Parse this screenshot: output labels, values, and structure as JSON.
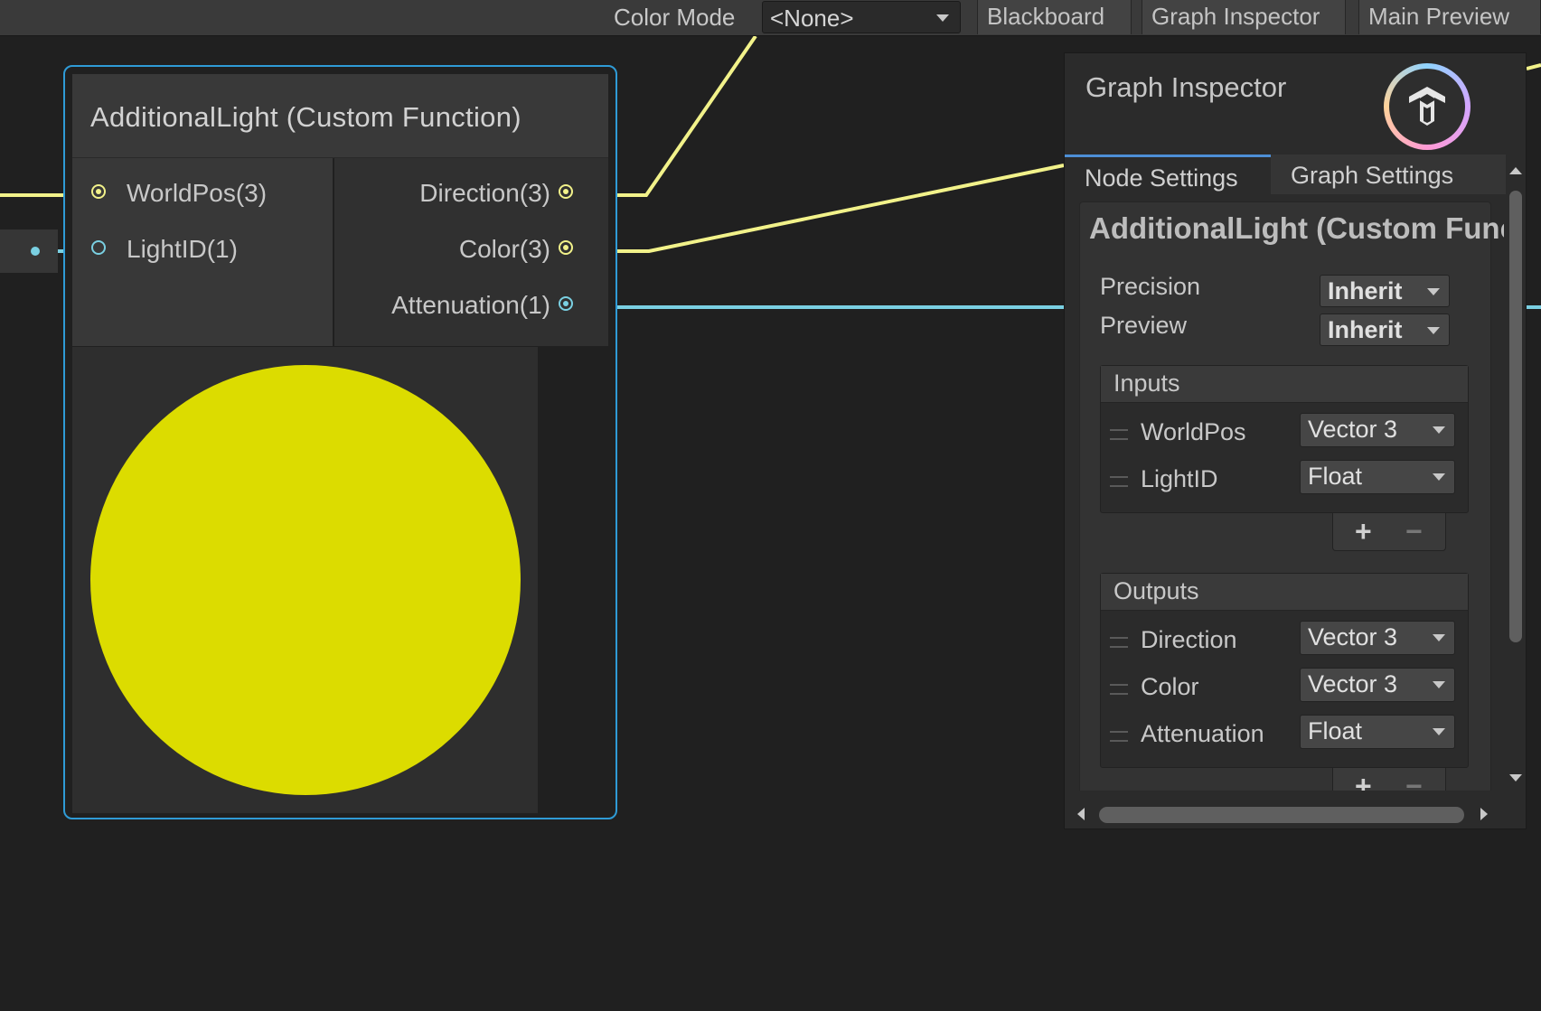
{
  "toolbar": {
    "color_mode_label": "Color Mode",
    "color_mode_value": "<None>",
    "blackboard": "Blackboard",
    "graph_inspector": "Graph Inspector",
    "main_preview": "Main Preview"
  },
  "node": {
    "title": "AdditionalLight (Custom Function)",
    "inputs": [
      {
        "label": "WorldPos(3)"
      },
      {
        "label": "LightID(1)"
      }
    ],
    "outputs": [
      {
        "label": "Direction(3)"
      },
      {
        "label": "Color(3)"
      },
      {
        "label": "Attenuation(1)"
      }
    ],
    "preview_color": "#dcdc00"
  },
  "colors": {
    "vector3_wire": "#f2f28a",
    "float_wire": "#7ad0e2",
    "selection_border": "#2f9bd6",
    "tab_accent": "#4d8fd6"
  },
  "inspector": {
    "title": "Graph Inspector",
    "tabs": {
      "node_settings": "Node Settings",
      "graph_settings": "Graph Settings"
    },
    "card_title": "AdditionalLight (Custom Function)",
    "precision_label": "Precision",
    "precision_value": "Inherit",
    "preview_label": "Preview",
    "preview_value": "Inherit",
    "inputs_title": "Inputs",
    "inputs": [
      {
        "name": "WorldPos",
        "type": "Vector 3"
      },
      {
        "name": "LightID",
        "type": "Float"
      }
    ],
    "outputs_title": "Outputs",
    "outputs": [
      {
        "name": "Direction",
        "type": "Vector 3"
      },
      {
        "name": "Color",
        "type": "Vector 3"
      },
      {
        "name": "Attenuation",
        "type": "Float"
      }
    ],
    "add_symbol": "+",
    "remove_symbol": "−"
  }
}
